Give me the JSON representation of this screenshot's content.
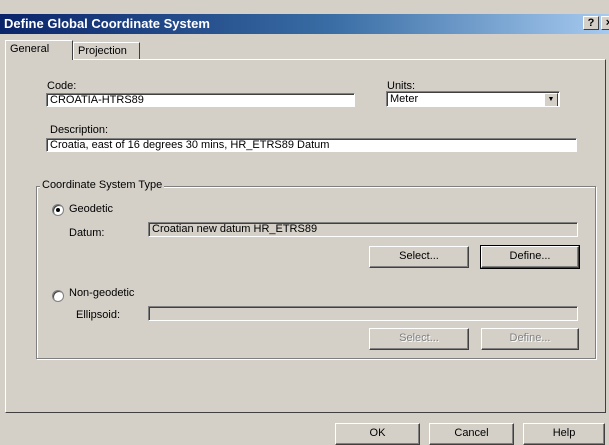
{
  "window": {
    "title": "Define Global Coordinate System",
    "help_glyph": "?",
    "close_glyph": "×"
  },
  "tabs": [
    {
      "label": "General",
      "active": true
    },
    {
      "label": "Projection",
      "active": false
    }
  ],
  "general": {
    "code_label": "Code:",
    "code_value": "CROATIA-HTRS89",
    "units_label": "Units:",
    "units_value": "Meter",
    "description_label": "Description:",
    "description_value": "Croatia, east of 16 degrees 30 mins, HR_ETRS89 Datum"
  },
  "coord_system_type": {
    "legend": "Coordinate System Type",
    "geodetic": {
      "label": "Geodetic",
      "selected": true,
      "datum_label": "Datum:",
      "datum_value": "Croatian new datum HR_ETRS89",
      "select_label": "Select...",
      "define_label": "Define..."
    },
    "non_geodetic": {
      "label": "Non-geodetic",
      "selected": false,
      "ellipsoid_label": "Ellipsoid:",
      "ellipsoid_value": "",
      "select_label": "Select...",
      "define_label": "Define..."
    }
  },
  "footer": {
    "ok_label": "OK",
    "cancel_label": "Cancel",
    "help_label": "Help"
  },
  "colors": {
    "title_start": "#0a246a",
    "title_end": "#a6caf0",
    "face": "#d4d0c8"
  }
}
